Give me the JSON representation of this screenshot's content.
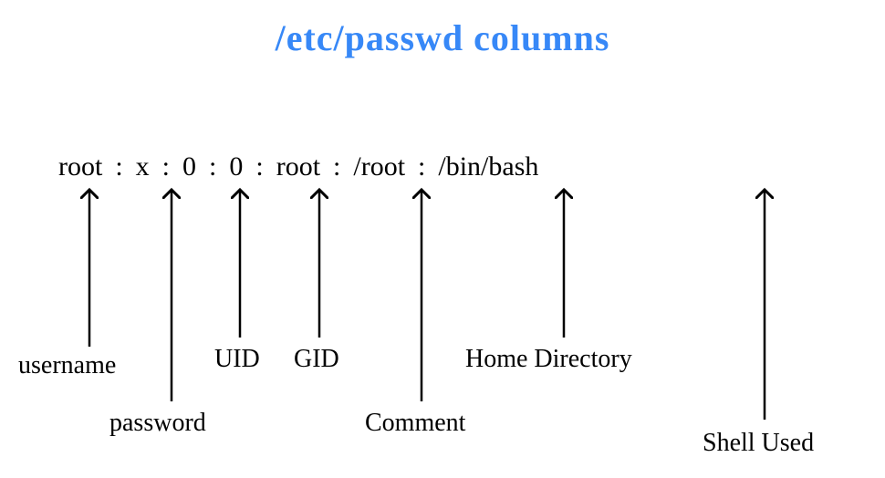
{
  "title": "/etc/passwd columns",
  "fields": {
    "username": "root",
    "password": "x",
    "uid": "0",
    "gid": "0",
    "comment": "root",
    "home": "/root",
    "shell": "/bin/bash"
  },
  "separator": ":",
  "labels": {
    "username": "username",
    "password": "password",
    "uid": "UID",
    "gid": "GID",
    "comment": "Comment",
    "home": "Home Directory",
    "shell": "Shell Used"
  }
}
